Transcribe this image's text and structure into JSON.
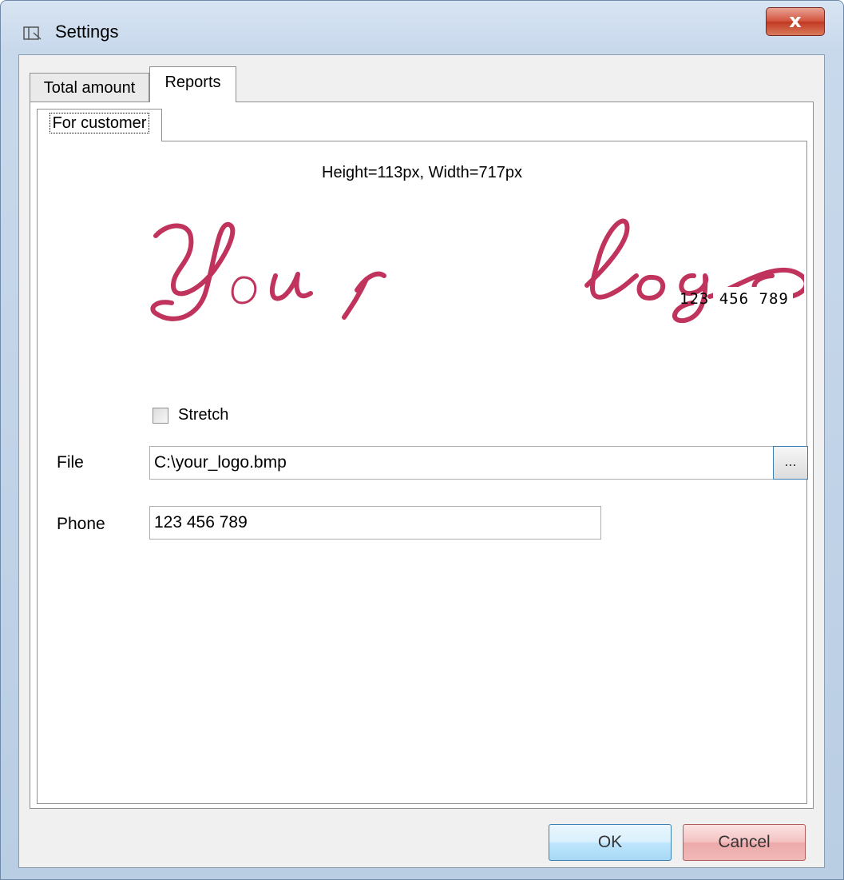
{
  "window": {
    "title": "Settings",
    "close_label": "x"
  },
  "tabs": [
    {
      "label": "Total amount",
      "active": false
    },
    {
      "label": "Reports",
      "active": true
    }
  ],
  "subtabs": [
    {
      "label": "For customer",
      "active": true
    }
  ],
  "logo_panel": {
    "dimensions_text": "Height=113px, Width=717px",
    "logo_script_text": "Your logo",
    "logo_phone_text": "123 456 789",
    "logo_color": "#c0335c"
  },
  "stretch_checkbox": {
    "label": "Stretch",
    "checked": false
  },
  "file_field": {
    "label": "File",
    "value": "C:\\your_logo.bmp",
    "browse_label": "..."
  },
  "phone_field": {
    "label": "Phone",
    "value": "123 456 789"
  },
  "buttons": {
    "ok": "OK",
    "cancel": "Cancel"
  }
}
